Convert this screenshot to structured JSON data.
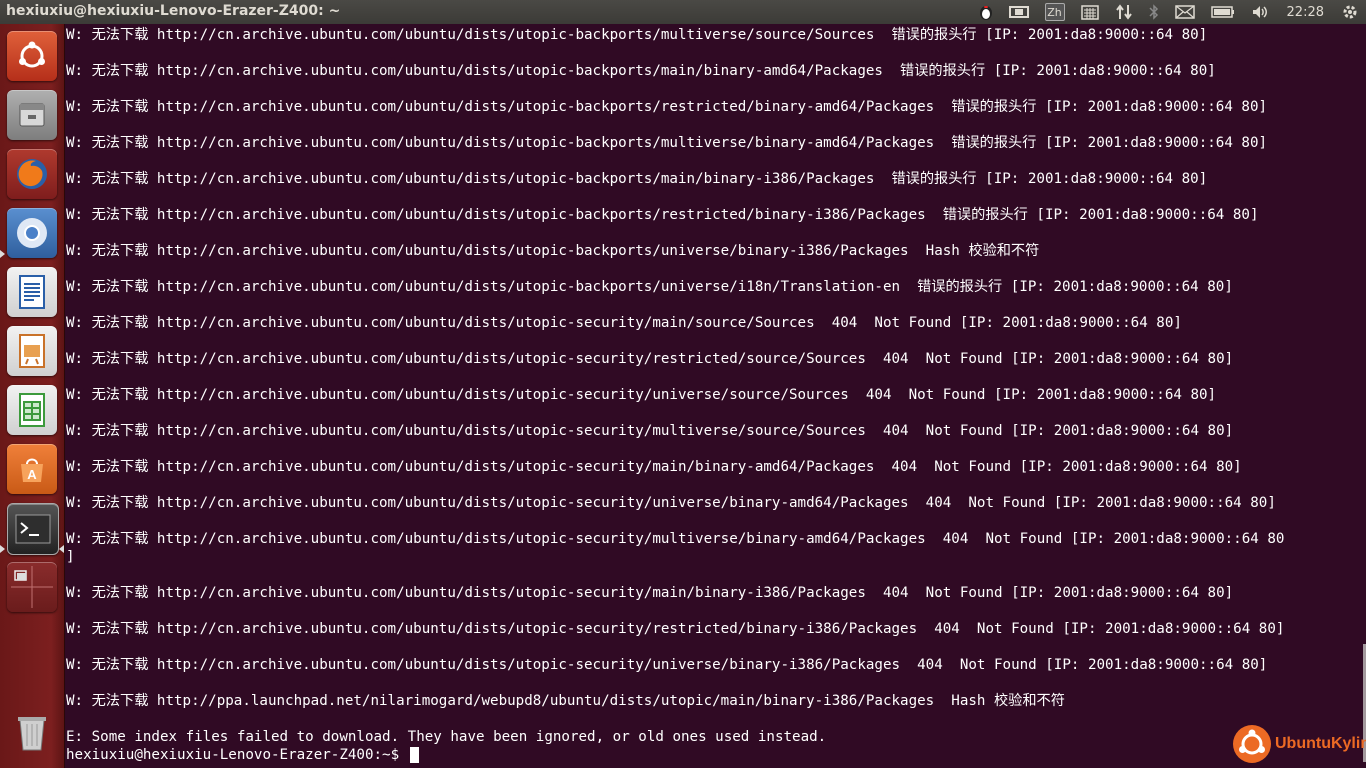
{
  "window": {
    "title": "hexiuxiu@hexiuxiu-Lenovo-Erazer-Z400: ~"
  },
  "panel": {
    "indicators": [
      {
        "name": "penguin-icon"
      },
      {
        "name": "keyboard-icon"
      },
      {
        "name": "input-method-icon",
        "label": "Zh"
      },
      {
        "name": "calendar-icon"
      },
      {
        "name": "network-icon"
      },
      {
        "name": "bluetooth-icon"
      },
      {
        "name": "mail-icon"
      },
      {
        "name": "battery-icon"
      },
      {
        "name": "volume-icon"
      }
    ],
    "clock": "22:28"
  },
  "launcher": {
    "items": [
      {
        "name": "dash-home-icon",
        "color": "#d4482b"
      },
      {
        "name": "files-icon",
        "color": "#8d8d8d"
      },
      {
        "name": "firefox-icon",
        "color": "#e66000"
      },
      {
        "name": "chromium-icon",
        "color": "#4b7ec6"
      },
      {
        "name": "writer-icon",
        "color": "#4a7fc1"
      },
      {
        "name": "impress-icon",
        "color": "#c97a2a"
      },
      {
        "name": "calc-icon",
        "color": "#3c9a3c"
      },
      {
        "name": "software-center-icon",
        "color": "#e67e22"
      },
      {
        "name": "terminal-icon",
        "color": "#2d2d2d"
      },
      {
        "name": "workspace-switcher-icon",
        "color": "#7a2a2a"
      },
      {
        "name": "trash-icon",
        "color": "#8d8d8d"
      }
    ]
  },
  "terminal": {
    "lines": [
      "W: 无法下载 http://cn.archive.ubuntu.com/ubuntu/dists/utopic-backports/multiverse/source/Sources  错误的报头行 [IP: 2001:da8:9000::64 80]",
      "W: 无法下载 http://cn.archive.ubuntu.com/ubuntu/dists/utopic-backports/main/binary-amd64/Packages  错误的报头行 [IP: 2001:da8:9000::64 80]",
      "W: 无法下载 http://cn.archive.ubuntu.com/ubuntu/dists/utopic-backports/restricted/binary-amd64/Packages  错误的报头行 [IP: 2001:da8:9000::64 80]",
      "W: 无法下载 http://cn.archive.ubuntu.com/ubuntu/dists/utopic-backports/multiverse/binary-amd64/Packages  错误的报头行 [IP: 2001:da8:9000::64 80]",
      "W: 无法下载 http://cn.archive.ubuntu.com/ubuntu/dists/utopic-backports/main/binary-i386/Packages  错误的报头行 [IP: 2001:da8:9000::64 80]",
      "W: 无法下载 http://cn.archive.ubuntu.com/ubuntu/dists/utopic-backports/restricted/binary-i386/Packages  错误的报头行 [IP: 2001:da8:9000::64 80]",
      "W: 无法下载 http://cn.archive.ubuntu.com/ubuntu/dists/utopic-backports/universe/binary-i386/Packages  Hash 校验和不符",
      "W: 无法下载 http://cn.archive.ubuntu.com/ubuntu/dists/utopic-backports/universe/i18n/Translation-en  错误的报头行 [IP: 2001:da8:9000::64 80]",
      "W: 无法下载 http://cn.archive.ubuntu.com/ubuntu/dists/utopic-security/main/source/Sources  404  Not Found [IP: 2001:da8:9000::64 80]",
      "W: 无法下载 http://cn.archive.ubuntu.com/ubuntu/dists/utopic-security/restricted/source/Sources  404  Not Found [IP: 2001:da8:9000::64 80]",
      "W: 无法下载 http://cn.archive.ubuntu.com/ubuntu/dists/utopic-security/universe/source/Sources  404  Not Found [IP: 2001:da8:9000::64 80]",
      "W: 无法下载 http://cn.archive.ubuntu.com/ubuntu/dists/utopic-security/multiverse/source/Sources  404  Not Found [IP: 2001:da8:9000::64 80]",
      "W: 无法下载 http://cn.archive.ubuntu.com/ubuntu/dists/utopic-security/main/binary-amd64/Packages  404  Not Found [IP: 2001:da8:9000::64 80]",
      "W: 无法下载 http://cn.archive.ubuntu.com/ubuntu/dists/utopic-security/universe/binary-amd64/Packages  404  Not Found [IP: 2001:da8:9000::64 80]",
      "W: 无法下载 http://cn.archive.ubuntu.com/ubuntu/dists/utopic-security/multiverse/binary-amd64/Packages  404  Not Found [IP: 2001:da8:9000::64 80",
      "]",
      "W: 无法下载 http://cn.archive.ubuntu.com/ubuntu/dists/utopic-security/main/binary-i386/Packages  404  Not Found [IP: 2001:da8:9000::64 80]",
      "W: 无法下载 http://cn.archive.ubuntu.com/ubuntu/dists/utopic-security/restricted/binary-i386/Packages  404  Not Found [IP: 2001:da8:9000::64 80]",
      "W: 无法下载 http://cn.archive.ubuntu.com/ubuntu/dists/utopic-security/universe/binary-i386/Packages  404  Not Found [IP: 2001:da8:9000::64 80]",
      "W: 无法下载 http://ppa.launchpad.net/nilarimogard/webupd8/ubuntu/dists/utopic/main/binary-i386/Packages  Hash 校验和不符",
      "E: Some index files failed to download. They have been ignored, or old ones used instead."
    ],
    "prompt": "hexiuxiu@hexiuxiu-Lenovo-Erazer-Z400:~$ "
  },
  "branding": {
    "label": "UbuntuKylin"
  }
}
